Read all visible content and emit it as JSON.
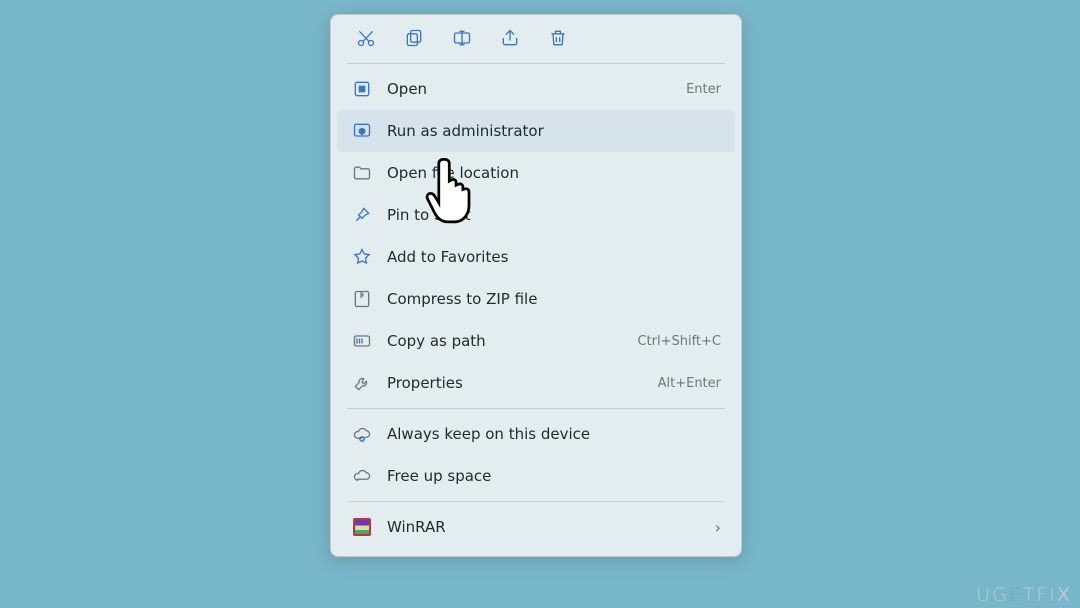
{
  "toolbar": [
    "cut",
    "copy",
    "rename",
    "share",
    "delete"
  ],
  "items": [
    {
      "icon": "open",
      "label": "Open",
      "shortcut": "Enter"
    },
    {
      "icon": "shield",
      "label": "Run as administrator",
      "hover": true
    },
    {
      "icon": "folder",
      "label": "Open file location"
    },
    {
      "icon": "pin",
      "label": "Pin to Start"
    },
    {
      "icon": "star",
      "label": "Add to Favorites"
    },
    {
      "icon": "zip",
      "label": "Compress to ZIP file"
    },
    {
      "icon": "path",
      "label": "Copy as path",
      "shortcut": "Ctrl+Shift+C"
    },
    {
      "icon": "props",
      "label": "Properties",
      "shortcut": "Alt+Enter"
    }
  ],
  "cloud": [
    {
      "icon": "cloud-keep",
      "label": "Always keep on this device"
    },
    {
      "icon": "cloud-free",
      "label": "Free up space"
    }
  ],
  "ext": [
    {
      "icon": "winrar",
      "label": "WinRAR",
      "submenu": true
    }
  ],
  "watermark": "UGETFIX"
}
